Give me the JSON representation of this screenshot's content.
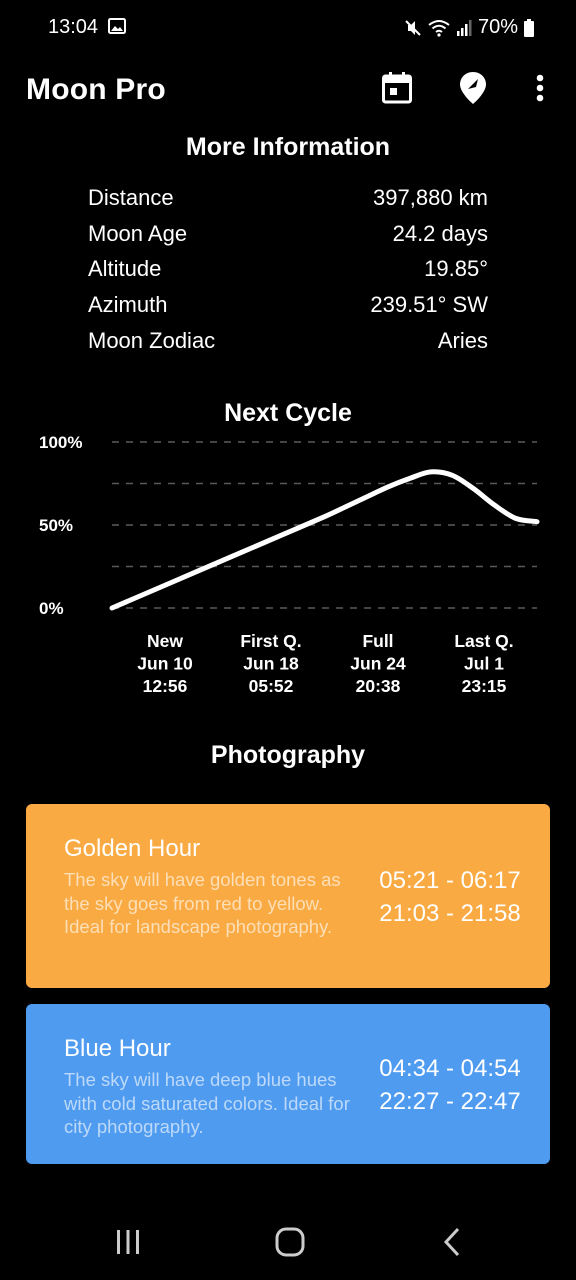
{
  "status_bar": {
    "time": "13:04",
    "battery": "70%"
  },
  "app_bar": {
    "title": "Moon Pro",
    "icons": [
      "calendar-icon",
      "location-pin-icon",
      "more-vert-icon"
    ]
  },
  "more_info": {
    "title": "More Information",
    "rows": [
      {
        "label": "Distance",
        "value": "397,880 km"
      },
      {
        "label": "Moon Age",
        "value": "24.2 days"
      },
      {
        "label": "Altitude",
        "value": "19.85°"
      },
      {
        "label": "Azimuth",
        "value": "239.51° SW"
      },
      {
        "label": "Moon Zodiac",
        "value": "Aries"
      }
    ]
  },
  "next_cycle": {
    "title": "Next Cycle",
    "phases": [
      {
        "name": "New",
        "date": "Jun 10",
        "time": "12:56"
      },
      {
        "name": "First Q.",
        "date": "Jun 18",
        "time": "05:52"
      },
      {
        "name": "Full",
        "date": "Jun 24",
        "time": "20:38"
      },
      {
        "name": "Last Q.",
        "date": "Jul 1",
        "time": "23:15"
      }
    ]
  },
  "chart_data": {
    "type": "line",
    "title": "Next Cycle",
    "y_tick_labels": [
      "100%",
      "50%",
      "0%"
    ],
    "ylim": [
      0,
      100
    ],
    "grid": true,
    "x_categories": [
      "New Jun 10 12:56",
      "First Q. Jun 18 05:52",
      "Full Jun 24 20:38",
      "Last Q. Jul 1 23:15"
    ],
    "series": [
      {
        "x": [
          0,
          0.1,
          0.2,
          0.3,
          0.4,
          0.5,
          0.55,
          0.6,
          0.65,
          0.7,
          0.75,
          0.8,
          0.85,
          0.9,
          0.95,
          1.0
        ],
        "y": [
          0,
          11,
          22,
          33,
          44,
          55,
          61,
          67,
          73,
          78,
          82,
          80,
          72,
          62,
          54,
          52
        ]
      }
    ],
    "line_color": "#ffffff"
  },
  "photography": {
    "title": "Photography",
    "golden": {
      "title": "Golden Hour",
      "desc": "The sky will have golden tones as the sky goes from red to yellow. Ideal for landscape photography.",
      "time1": "05:21 - 06:17",
      "time2": "21:03 - 21:58",
      "color": "#f9aa42"
    },
    "blue": {
      "title": "Blue Hour",
      "desc": "The sky will have deep blue hues with cold saturated colors. Ideal for city photography.",
      "time1": "04:34 - 04:54",
      "time2": "22:27 - 22:47",
      "color": "#4f9bf0"
    }
  },
  "nav_bar": {
    "icons": [
      "recent-apps-icon",
      "home-icon",
      "back-icon"
    ]
  }
}
